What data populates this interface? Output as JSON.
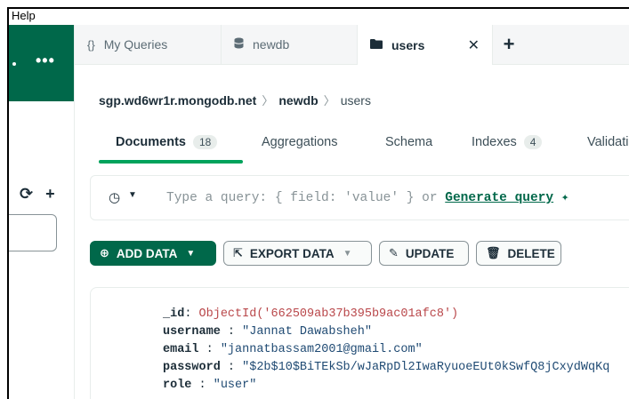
{
  "menu": {
    "help": "Help"
  },
  "sidebar": {
    "more_icon": "ellipsis-icon",
    "refresh_icon": "refresh-icon",
    "add_icon": "plus-icon"
  },
  "tabs": [
    {
      "icon": "{}",
      "label": "My Queries"
    },
    {
      "icon": "db-icon",
      "label": "newdb"
    },
    {
      "icon": "folder-icon",
      "label": "users"
    }
  ],
  "breadcrumb": {
    "host": "sgp.wd6wr1r.mongodb.net",
    "db": "newdb",
    "collection": "users"
  },
  "subtabs": {
    "documents": {
      "label": "Documents",
      "count": "18"
    },
    "aggregations": {
      "label": "Aggregations"
    },
    "schema": {
      "label": "Schema"
    },
    "indexes": {
      "label": "Indexes",
      "count": "4"
    },
    "validation": {
      "label": "Validati"
    }
  },
  "query": {
    "placeholder": "Type a query: { field: 'value' } or ",
    "generate": "Generate query",
    "spark": "✦"
  },
  "toolbar": {
    "add_data": "ADD DATA",
    "export_data": "EXPORT DATA",
    "update": "UPDATE",
    "delete": "DELETE"
  },
  "document": {
    "id_key": "_id",
    "id_value": "ObjectId('662509ab37b395b9ac01afc8')",
    "username_key": "username",
    "username_value": "\"Jannat Dawabsheh\"",
    "email_key": "email",
    "email_value": "\"jannatbassam2001@gmail.com\"",
    "password_key": "password",
    "password_value": "\"$2b$10$BiTEkSb/wJaRpDl2IwaRyuoeEUt0kSwfQ8jCxydWqKq",
    "role_key": "role",
    "role_value": "\"user\""
  }
}
